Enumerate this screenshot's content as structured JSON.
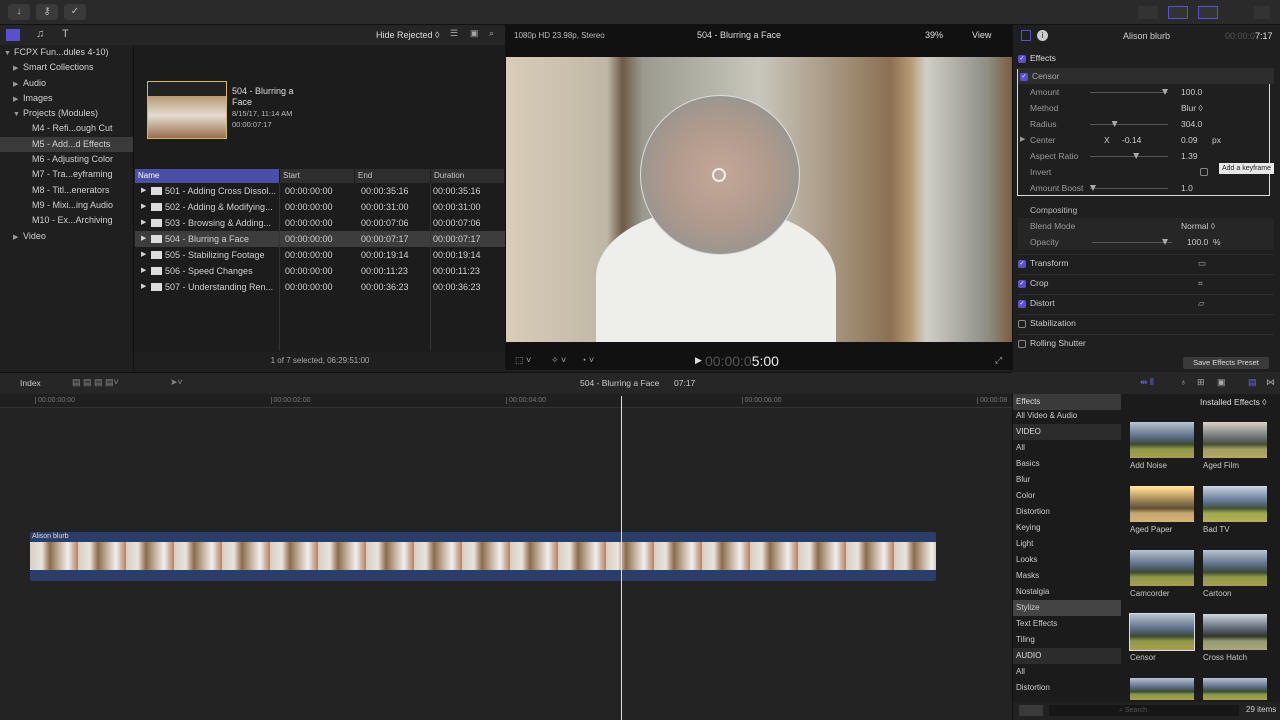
{
  "toolbar": {
    "import_icon": "download-icon",
    "keywords_icon": "key-icon",
    "check_icon": "checkmark-circle-icon"
  },
  "library": {
    "filter": "Hide Rejected ◊",
    "items": [
      {
        "label": "FCPX Fun...dules 4-10)",
        "level": 0,
        "tri": "▼"
      },
      {
        "label": "Smart Collections",
        "level": 1,
        "tri": "▶"
      },
      {
        "label": "Audio",
        "level": 1,
        "tri": "▶"
      },
      {
        "label": "Images",
        "level": 1,
        "tri": "▶"
      },
      {
        "label": "Projects (Modules)",
        "level": 1,
        "tri": "▼"
      },
      {
        "label": "M4 - Refi...ough Cut",
        "level": 2,
        "tri": ""
      },
      {
        "label": "M5 - Add...d Effects",
        "level": 2,
        "tri": "",
        "selected": true
      },
      {
        "label": "M6 - Adjusting Color",
        "level": 2,
        "tri": ""
      },
      {
        "label": "M7 - Tra...eyframing",
        "level": 2,
        "tri": ""
      },
      {
        "label": "M8 - Titl...enerators",
        "level": 2,
        "tri": ""
      },
      {
        "label": "M9 - Mixi...ing Audio",
        "level": 2,
        "tri": ""
      },
      {
        "label": "M10 - Ex...Archiving",
        "level": 2,
        "tri": ""
      },
      {
        "label": "Video",
        "level": 1,
        "tri": "▶"
      }
    ]
  },
  "browser": {
    "preview": {
      "title_line1": "504 - Blurring a",
      "title_line2": "Face",
      "date": "8/15/17, 11:14 AM",
      "duration": "00:00:07:17"
    },
    "columns": [
      "Name",
      "Start",
      "End",
      "Duration"
    ],
    "rows": [
      [
        "501 - Adding Cross Dissol...",
        "00:00:00:00",
        "00:00:35:16",
        "00:00:35:16"
      ],
      [
        "502 - Adding & Modifying...",
        "00:00:00:00",
        "00:00:31:00",
        "00:00:31:00"
      ],
      [
        "503 - Browsing & Adding...",
        "00:00:00:00",
        "00:00:07:06",
        "00:00:07:06"
      ],
      [
        "504 - Blurring a Face",
        "00:00:00:00",
        "00:00:07:17",
        "00:00:07:17"
      ],
      [
        "505 - Stabilizing Footage",
        "00:00:00:00",
        "00:00:19:14",
        "00:00:19:14"
      ],
      [
        "506 - Speed Changes",
        "00:00:00:00",
        "00:00:11:23",
        "00:00:11:23"
      ],
      [
        "507 - Understanding Ren...",
        "00:00:00:00",
        "00:00:36:23",
        "00:00:36:23"
      ]
    ],
    "selected_row": 3,
    "status": "1 of 7 selected, 06:29:51:00"
  },
  "viewer": {
    "format": "1080p HD 23.98p, Stereo",
    "title": "504 - Blurring a Face",
    "zoom": "39%",
    "view": "View",
    "timecode_dim": "00:00:0",
    "timecode": "5:00"
  },
  "inspector": {
    "title": "Alison blurb",
    "timecode_dim": "00:00:0",
    "timecode": "7:17",
    "effects_label": "Effects",
    "censor_label": "Censor",
    "params": [
      {
        "label": "Amount",
        "value": "100.0",
        "slider": 1.0
      },
      {
        "label": "Method",
        "value": "Blur ◊"
      },
      {
        "label": "Radius",
        "value": "304.0",
        "slider": 0.3
      },
      {
        "label": "Center",
        "x_label": "X",
        "x": "-0.14",
        "value": "0.09",
        "unit": "px"
      },
      {
        "label": "Aspect Ratio",
        "value": "1.39",
        "slider": 0.6
      },
      {
        "label": "Invert",
        "value": ""
      },
      {
        "label": "Amount Boost",
        "value": "1.0",
        "slider": 0.0
      }
    ],
    "compositing_label": "Compositing",
    "blend_label": "Blend Mode",
    "blend_value": "Normal ◊",
    "opacity_label": "Opacity",
    "opacity_value": "100.0",
    "opacity_unit": "%",
    "tooltip": "Add a keyframe",
    "sections": [
      {
        "label": "Transform",
        "checked": true
      },
      {
        "label": "Crop",
        "checked": true
      },
      {
        "label": "Distort",
        "checked": true
      },
      {
        "label": "Stabilization",
        "checked": false
      },
      {
        "label": "Rolling Shutter",
        "checked": false
      }
    ],
    "save_preset": "Save Effects Preset"
  },
  "timeline": {
    "index": "Index",
    "title": "504 - Blurring a Face",
    "duration": "07:17",
    "ruler": [
      "00:00:00:00",
      "00:00:02:00",
      "00:00:04:00",
      "00:00:06:00",
      "00:00:08"
    ],
    "clip_name": "Alison blurb",
    "playhead_fraction": 0.653
  },
  "effects_browser": {
    "title": "Effects",
    "source": "Installed Effects ◊",
    "categories": [
      {
        "label": "All Video & Audio"
      },
      {
        "label": "VIDEO",
        "header": true
      },
      {
        "label": "All"
      },
      {
        "label": "Basics"
      },
      {
        "label": "Blur"
      },
      {
        "label": "Color"
      },
      {
        "label": "Distortion"
      },
      {
        "label": "Keying"
      },
      {
        "label": "Light"
      },
      {
        "label": "Looks"
      },
      {
        "label": "Masks"
      },
      {
        "label": "Nostalgia"
      },
      {
        "label": "Stylize",
        "selected": true
      },
      {
        "label": "Text Effects"
      },
      {
        "label": "Tiling"
      },
      {
        "label": "AUDIO",
        "header": true
      },
      {
        "label": "All"
      },
      {
        "label": "Distortion"
      }
    ],
    "items": [
      "Add Noise",
      "Aged Film",
      "Aged Paper",
      "Bad TV",
      "Camcorder",
      "Cartoon",
      "Censor",
      "Cross Hatch"
    ],
    "search_placeholder": "Search",
    "count": "29 items"
  },
  "colors": {
    "accent": "#5a4fd0",
    "selection": "#4a4fa8",
    "clip": "#2a3d6b"
  }
}
